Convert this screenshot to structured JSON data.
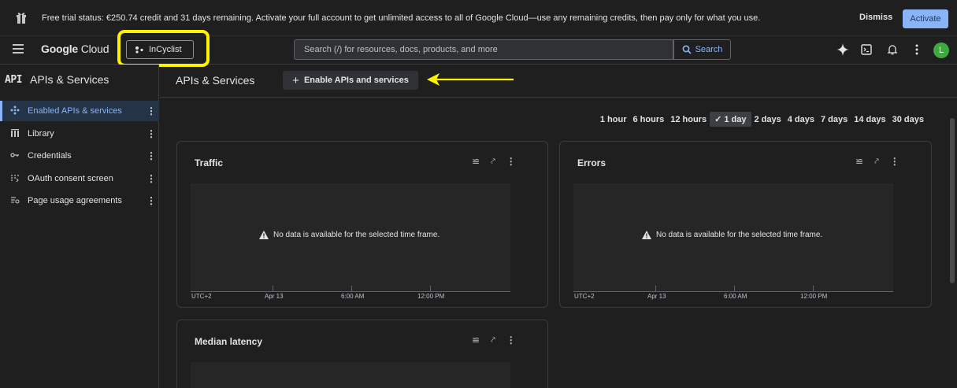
{
  "banner": {
    "message": "Free trial status: €250.74 credit and 31 days remaining. Activate your full account to get unlimited access to all of Google Cloud—use any remaining credits, then pay only for what you use.",
    "dismiss_label": "Dismiss",
    "activate_label": "Activate",
    "icon": "gift-icon"
  },
  "topbar": {
    "logo_word1": "Google",
    "logo_word2": "Cloud",
    "project_name": "InCyclist",
    "search_placeholder": "Search (/) for resources, docs, products, and more",
    "search_button_label": "Search",
    "avatar_letter": "L",
    "avatar_color": "#3da93f"
  },
  "sidebar": {
    "badge": "API",
    "title": "APIs & Services",
    "items": [
      {
        "label": "Enabled APIs & services",
        "icon": "enabled-apis-icon",
        "active": true
      },
      {
        "label": "Library",
        "icon": "library-icon",
        "active": false
      },
      {
        "label": "Credentials",
        "icon": "key-icon",
        "active": false
      },
      {
        "label": "OAuth consent screen",
        "icon": "oauth-icon",
        "active": false
      },
      {
        "label": "Page usage agreements",
        "icon": "agreements-icon",
        "active": false
      }
    ]
  },
  "main": {
    "title": "APIs & Services",
    "enable_button_label": "Enable APIs and services",
    "time_ranges": [
      "1 hour",
      "6 hours",
      "12 hours",
      "1 day",
      "2 days",
      "4 days",
      "7 days",
      "14 days",
      "30 days"
    ],
    "selected_time_range": "1 day",
    "cards": [
      {
        "title": "Traffic",
        "no_data": "No data is available for the selected time frame.",
        "ticks": [
          "UTC+2",
          "Apr 13",
          "6:00 AM",
          "12:00 PM"
        ]
      },
      {
        "title": "Errors",
        "no_data": "No data is available for the selected time frame.",
        "ticks": [
          "UTC+2",
          "Apr 13",
          "6:00 AM",
          "12:00 PM"
        ]
      },
      {
        "title": "Median latency"
      }
    ]
  },
  "colors": {
    "accent": "#8ab4f8",
    "highlight": "#fff200"
  }
}
